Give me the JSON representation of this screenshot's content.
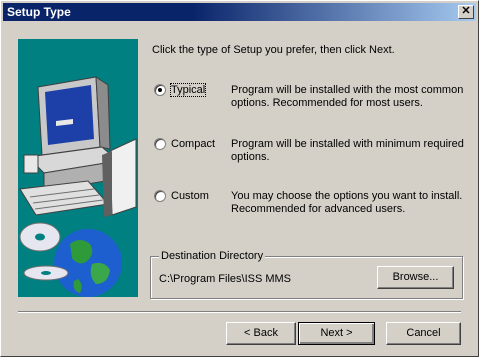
{
  "window": {
    "title": "Setup Type"
  },
  "intro": "Click the type of Setup you prefer, then click Next.",
  "options": [
    {
      "label": "Typical",
      "selected": true,
      "desc1": "Program will be installed with the most common",
      "desc2": "options. Recommended for most users."
    },
    {
      "label": "Compact",
      "selected": false,
      "desc1": "Program will be installed with minimum required",
      "desc2": "options."
    },
    {
      "label": "Custom",
      "selected": false,
      "desc1": "You may choose the options you want to install.",
      "desc2": "Recommended for advanced users."
    }
  ],
  "destination": {
    "legend": "Destination Directory",
    "path": "C:\\Program Files\\ISS MMS",
    "browse_label": "Browse..."
  },
  "buttons": {
    "back": "< Back",
    "next": "Next >",
    "cancel": "Cancel"
  },
  "colors": {
    "titlebar": "#0a246a",
    "illustration_bg": "#008080",
    "face": "#d4d0c8"
  }
}
